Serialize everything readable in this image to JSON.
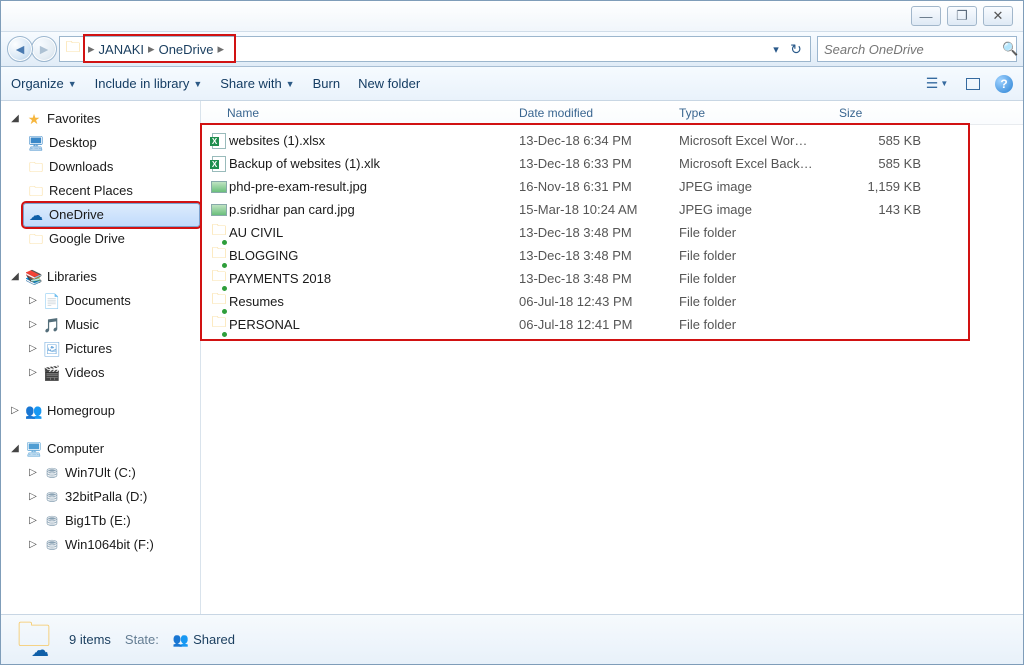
{
  "window": {
    "minimize": "—",
    "maximize": "❐",
    "close": "✕"
  },
  "nav": {
    "breadcrumb1": "JANAKI",
    "breadcrumb2": "OneDrive",
    "search_placeholder": "Search OneDrive"
  },
  "toolbar": {
    "organize": "Organize",
    "include": "Include in library",
    "share": "Share with",
    "burn": "Burn",
    "newfolder": "New folder"
  },
  "columns": {
    "name": "Name",
    "date": "Date modified",
    "type": "Type",
    "size": "Size"
  },
  "sidebar": {
    "favorites": "Favorites",
    "desktop": "Desktop",
    "downloads": "Downloads",
    "recent": "Recent Places",
    "onedrive": "OneDrive",
    "gdrive": "Google Drive",
    "libraries": "Libraries",
    "documents": "Documents",
    "music": "Music",
    "pictures": "Pictures",
    "videos": "Videos",
    "homegroup": "Homegroup",
    "computer": "Computer",
    "drive_c": "Win7Ult (C:)",
    "drive_d": "32bitPalla (D:)",
    "drive_e": "Big1Tb (E:)",
    "drive_f": "Win1064bit (F:)"
  },
  "files": [
    {
      "icon": "excel",
      "name": "websites (1).xlsx",
      "date": "13-Dec-18 6:34 PM",
      "type": "Microsoft Excel Wor…",
      "size": "585 KB"
    },
    {
      "icon": "excel",
      "name": "Backup of websites (1).xlk",
      "date": "13-Dec-18 6:33 PM",
      "type": "Microsoft Excel Back…",
      "size": "585 KB"
    },
    {
      "icon": "image",
      "name": "phd-pre-exam-result.jpg",
      "date": "16-Nov-18 6:31 PM",
      "type": "JPEG image",
      "size": "1,159 KB"
    },
    {
      "icon": "image",
      "name": "p.sridhar pan card.jpg",
      "date": "15-Mar-18 10:24 AM",
      "type": "JPEG image",
      "size": "143 KB"
    },
    {
      "icon": "folder",
      "name": "AU CIVIL",
      "date": "13-Dec-18 3:48 PM",
      "type": "File folder",
      "size": ""
    },
    {
      "icon": "folder",
      "name": "BLOGGING",
      "date": "13-Dec-18 3:48 PM",
      "type": "File folder",
      "size": ""
    },
    {
      "icon": "folder",
      "name": "PAYMENTS 2018",
      "date": "13-Dec-18 3:48 PM",
      "type": "File folder",
      "size": ""
    },
    {
      "icon": "folder",
      "name": "Resumes",
      "date": "06-Jul-18 12:43 PM",
      "type": "File folder",
      "size": ""
    },
    {
      "icon": "folder",
      "name": "PERSONAL",
      "date": "06-Jul-18 12:41 PM",
      "type": "File folder",
      "size": ""
    }
  ],
  "status": {
    "count": "9 items",
    "state_label": "State:",
    "state_value": "Shared"
  }
}
